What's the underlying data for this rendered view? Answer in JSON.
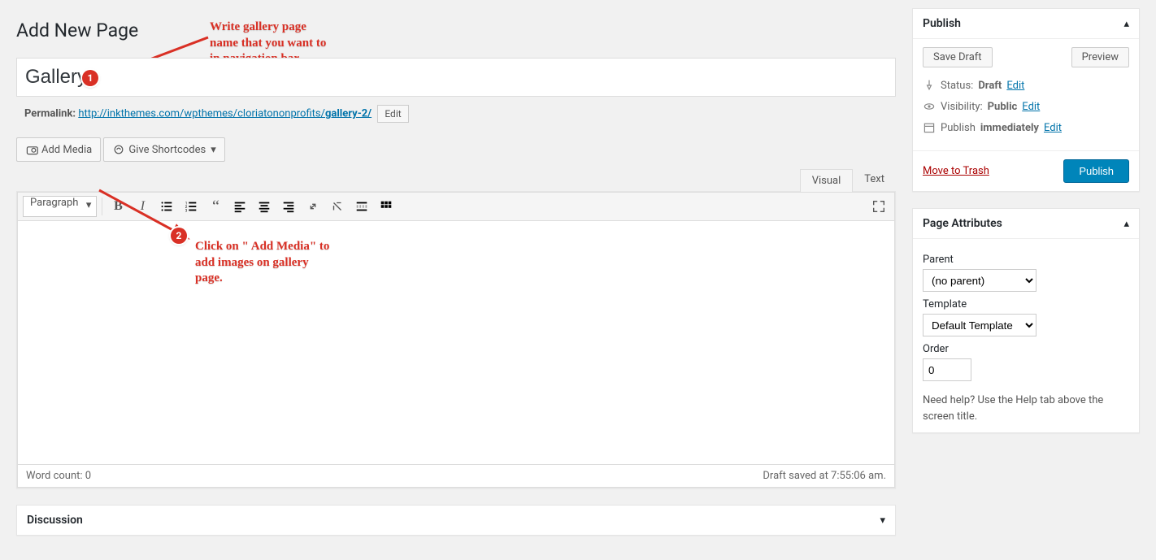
{
  "page": {
    "heading": "Add New Page"
  },
  "title": {
    "value": "Gallery"
  },
  "permalink": {
    "label": "Permalink:",
    "base": "http://inkthemes.com/wpthemes/cloriatononprofits/",
    "slug": "gallery-2/",
    "edit": "Edit"
  },
  "media": {
    "add": "Add Media",
    "give": "Give Shortcodes"
  },
  "editor": {
    "tabs": {
      "visual": "Visual",
      "text": "Text"
    },
    "format_dd": "Paragraph",
    "wordcount_label": "Word count:",
    "wordcount": "0",
    "saved_msg": "Draft saved at 7:55:06 am."
  },
  "discussion": {
    "title": "Discussion"
  },
  "publish": {
    "title": "Publish",
    "save_draft": "Save Draft",
    "preview": "Preview",
    "status_label": "Status:",
    "status_value": "Draft",
    "visibility_label": "Visibility:",
    "visibility_value": "Public",
    "publish_label": "Publish",
    "publish_value": "immediately",
    "edit": "Edit",
    "trash": "Move to Trash",
    "button": "Publish"
  },
  "attributes": {
    "title": "Page Attributes",
    "parent_label": "Parent",
    "parent_value": "(no parent)",
    "template_label": "Template",
    "template_value": "Default Template",
    "order_label": "Order",
    "order_value": "0",
    "help": "Need help? Use the Help tab above the screen title."
  },
  "annotations": {
    "one": "Write gallery page\nname that you want to\nin navigation bar.",
    "two": "Click on \" Add Media\" to\nadd images on gallery\npage."
  }
}
